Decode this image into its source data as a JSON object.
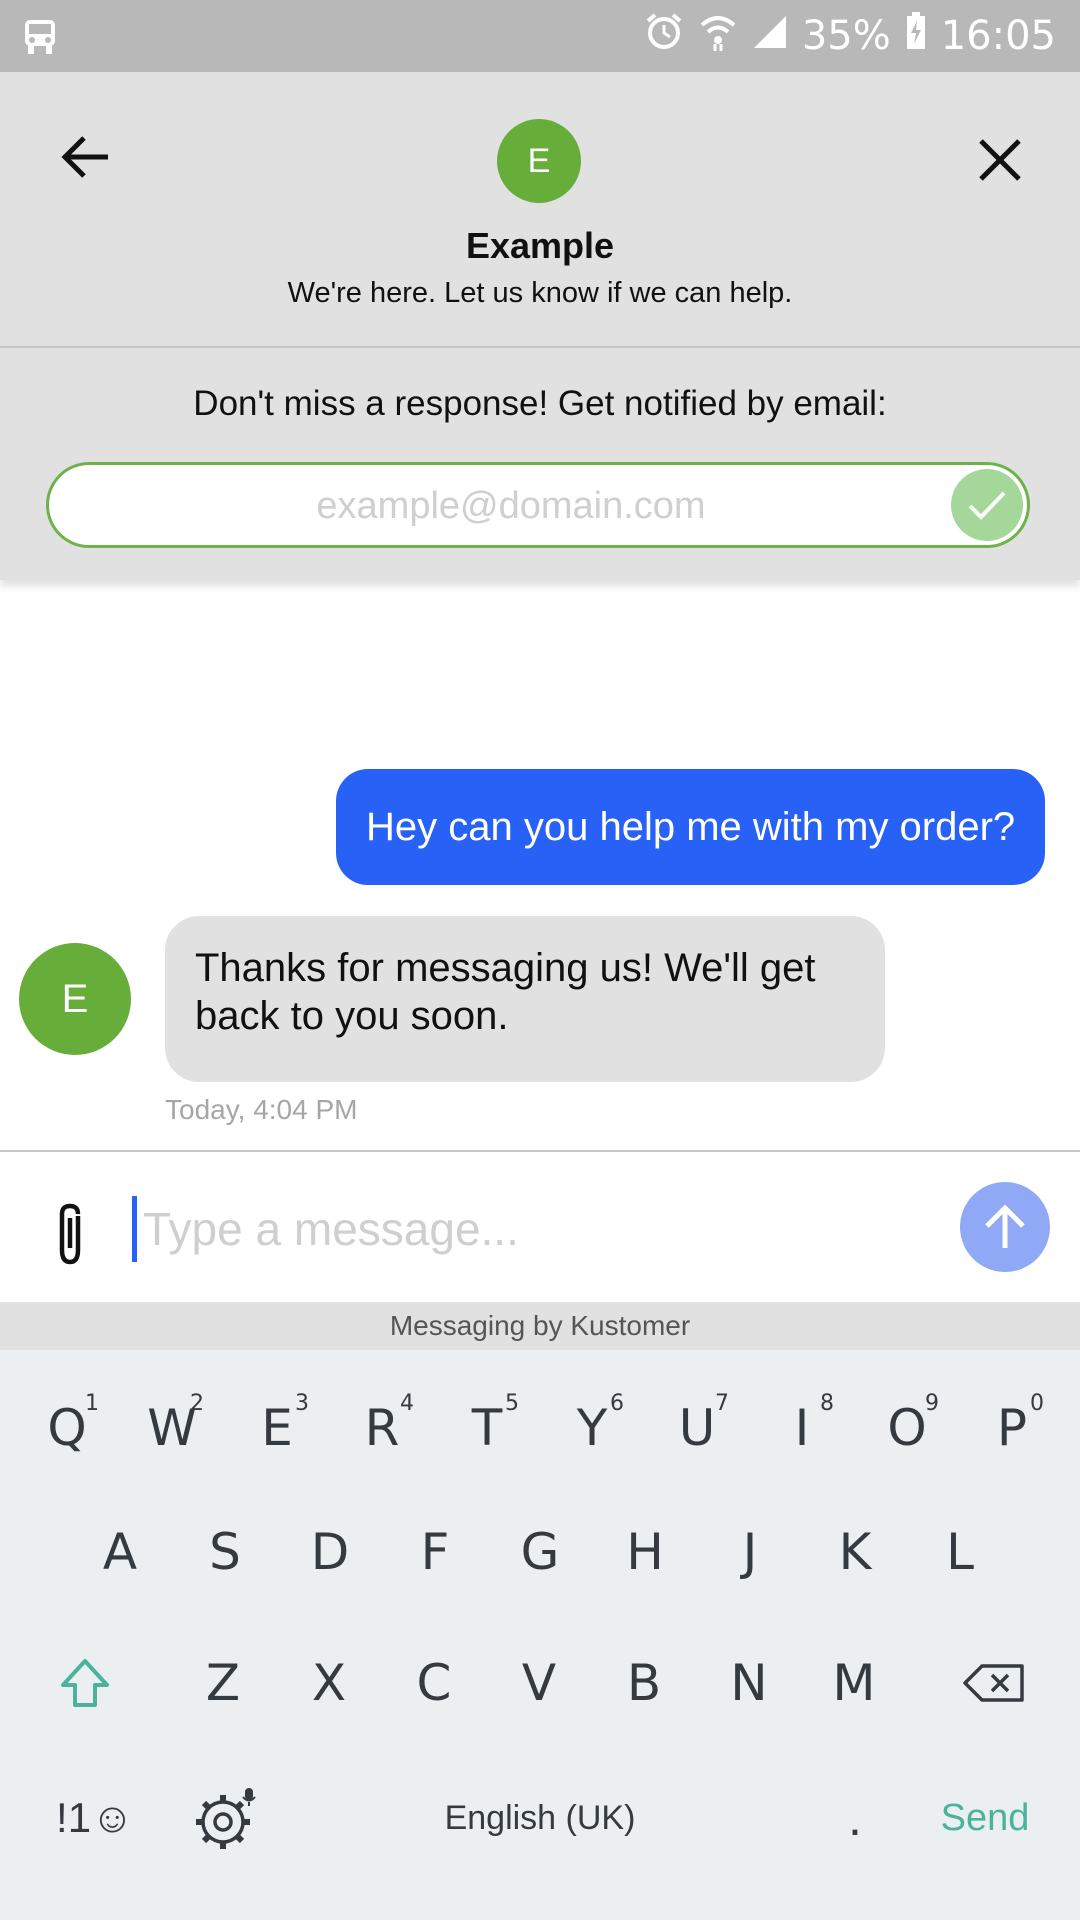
{
  "status_bar": {
    "battery": "35%",
    "time": "16:05"
  },
  "header": {
    "avatar_initial": "E",
    "title": "Example",
    "subtitle": "We're here. Let us know if we can help."
  },
  "notify": {
    "prompt": "Don't miss a response! Get notified by email:",
    "email_placeholder": "example@domain.com",
    "accent": "#6db24a"
  },
  "messages": {
    "user": {
      "text": "Hey can you help me with my order?",
      "color": "#2861f6"
    },
    "agent": {
      "avatar_initial": "E",
      "text": "Thanks for messaging us! We'll get back to you soon.",
      "timestamp": "Today, 4:04 PM"
    }
  },
  "composer": {
    "placeholder": "Type a message...",
    "attach_icon": "paperclip-icon",
    "send_icon": "arrow-up-icon"
  },
  "footer": {
    "powered_by": "Messaging by Kustomer"
  },
  "keyboard": {
    "row1": [
      {
        "key": "Q",
        "hint": "1"
      },
      {
        "key": "W",
        "hint": "2"
      },
      {
        "key": "E",
        "hint": "3"
      },
      {
        "key": "R",
        "hint": "4"
      },
      {
        "key": "T",
        "hint": "5"
      },
      {
        "key": "Y",
        "hint": "6"
      },
      {
        "key": "U",
        "hint": "7"
      },
      {
        "key": "I",
        "hint": "8"
      },
      {
        "key": "O",
        "hint": "9"
      },
      {
        "key": "P",
        "hint": "0"
      }
    ],
    "row2": [
      "A",
      "S",
      "D",
      "F",
      "G",
      "H",
      "J",
      "K",
      "L"
    ],
    "row3": [
      "Z",
      "X",
      "C",
      "V",
      "B",
      "N",
      "M"
    ],
    "symbols_label": "!1☺",
    "language": "English (UK)",
    "period": ".",
    "send_label": "Send",
    "accent": "#4bb29b"
  }
}
